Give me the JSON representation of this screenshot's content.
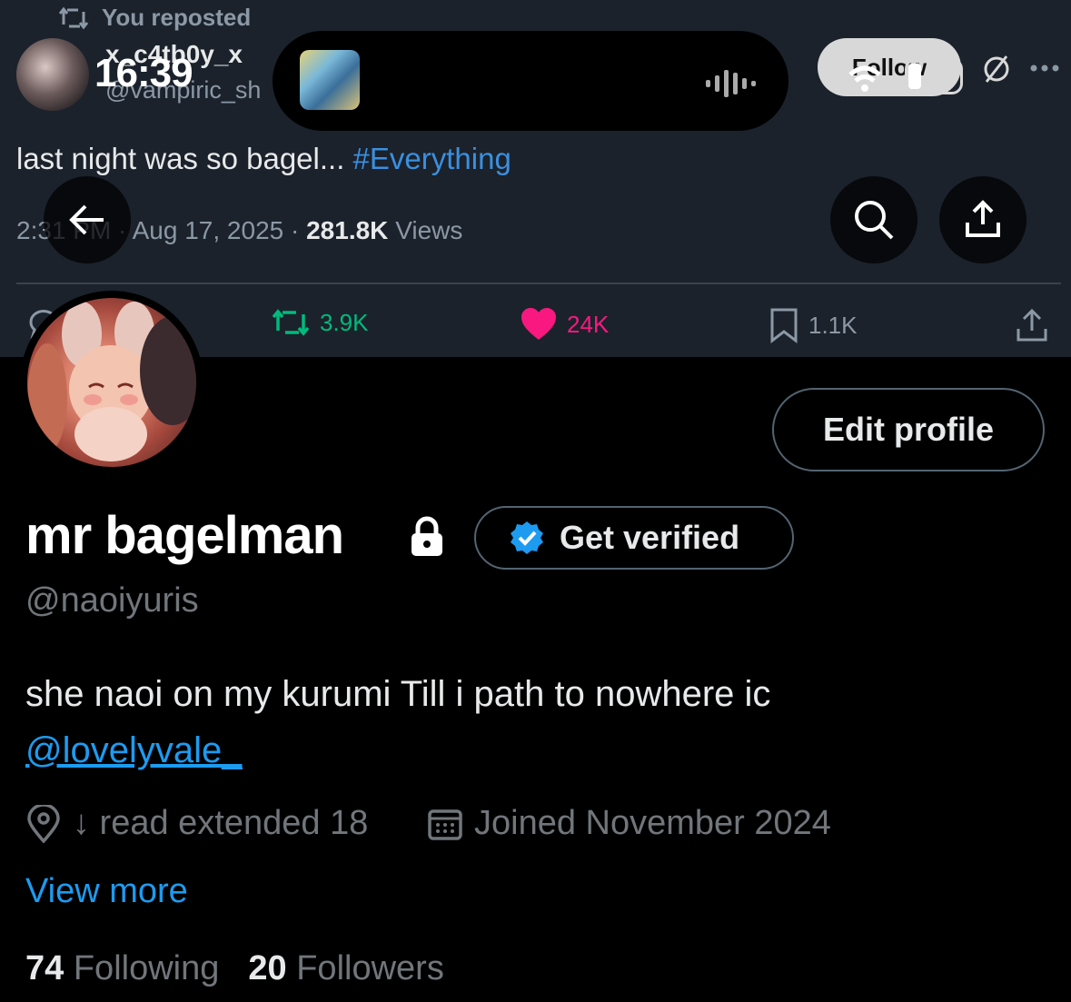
{
  "status_bar": {
    "time": "16:39",
    "follow_partial": "Follow"
  },
  "banner_tweet": {
    "repost_label": "You reposted",
    "author_name": "x_c4tb0y_x",
    "author_handle": "@vampiric_sh",
    "text": "last night was so bagel... ",
    "hashtag": "#Everything",
    "time": "2:31 PM",
    "date": "Aug 17, 2025",
    "views_count": "281.8K",
    "views_label": "Views",
    "reposts": "3.9K",
    "likes": "24K",
    "bookmarks": "1.1K"
  },
  "profile": {
    "edit_label": "Edit profile",
    "display_name": "mr bagelman",
    "verify_label": "Get verified",
    "handle": "@naoiyuris",
    "bio": "she naoi on my kurumi Till i path to nowhere ic",
    "bio_mention": "@lovelyvale_",
    "location": "↓ read extended 18",
    "joined": "Joined November 2024",
    "view_more": "View more",
    "following_count": "74",
    "following_label": "Following",
    "followers_count": "20",
    "followers_label": "Followers"
  },
  "colors": {
    "accent": "#1d9bf0",
    "like": "#f91880",
    "repost": "#00ba7c",
    "background": "#000000",
    "banner": "#1b222b"
  }
}
